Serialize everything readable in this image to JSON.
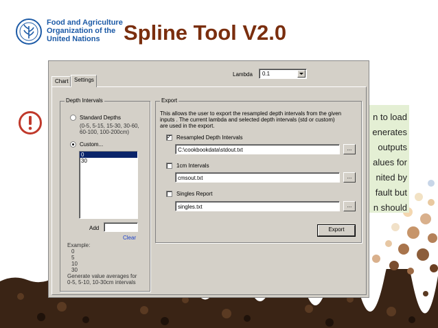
{
  "header": {
    "org_lines": [
      "Food and Agriculture",
      "Organization of the",
      "United Nations"
    ],
    "title": "Spline Tool V2.0"
  },
  "note_lines": [
    "n to load",
    "enerates",
    "outputs",
    "alues for",
    "nited by",
    "fault but",
    "n should"
  ],
  "dialog": {
    "tabs": [
      "Chart",
      "Settings"
    ],
    "active_tab": "Settings",
    "lambda": {
      "label": "Lambda",
      "value": "0.1"
    },
    "depth": {
      "legend": "Depth Intervals",
      "standard_label": "Standard Depths",
      "standard_desc": [
        "(0-5, 5-15, 15-30, 30-60,",
        "60-100, 100-200cm)"
      ],
      "custom_label": "Custom...",
      "list_items": [
        "0",
        "30"
      ],
      "selected_item": "0",
      "add_label": "Add",
      "add_value": "",
      "clear_label": "Clear",
      "example_lines": [
        "Example:",
        "0",
        "5",
        "10",
        "30",
        "Generate value averages for",
        "0-5, 5-10, 10-30cm intervals"
      ]
    },
    "export": {
      "legend": "Export",
      "description": [
        "This allows the user to export the resampled depth intervals from the given",
        "inputs . The current lambda and selected depth intervals (std or custom)",
        "are used in the export."
      ],
      "options": [
        {
          "label": "Resampled Depth Intervals",
          "checked": true,
          "path": "C:\\cookbookdata\\stdout.txt"
        },
        {
          "label": "1cm Intervals",
          "checked": false,
          "path": "cmsout.txt"
        },
        {
          "label": "Singles Report",
          "checked": false,
          "path": "singles.txt"
        }
      ],
      "browse_label": "...",
      "export_button": "Export"
    }
  },
  "colors": {
    "title": "#7a2e0e",
    "org": "#1c5aa6",
    "alert": "#c0392b",
    "note_bg": "#e4efd4"
  }
}
